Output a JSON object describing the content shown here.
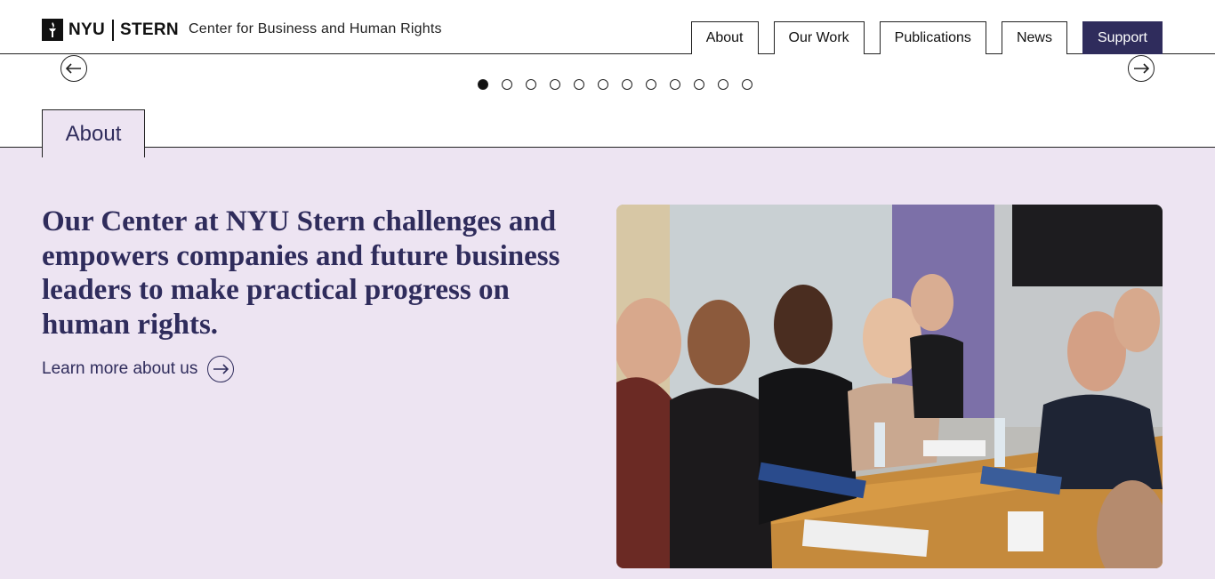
{
  "header": {
    "logo_text": "NYU",
    "logo_text2": "STERN",
    "center_name": "Center for Business and Human Rights",
    "nav": [
      {
        "label": "About"
      },
      {
        "label": "Our Work"
      },
      {
        "label": "Publications"
      },
      {
        "label": "News"
      },
      {
        "label": "Support"
      }
    ]
  },
  "carousel": {
    "prev_icon": "arrow-left-icon",
    "next_icon": "arrow-right-icon",
    "slide_count": 12,
    "active_index": 0
  },
  "about": {
    "tab_label": "About",
    "heading": "Our Center at NYU Stern challenges and empowers companies and future business leaders to make practical progress on human rights.",
    "learn_more": "Learn more about us"
  },
  "colors": {
    "brand_purple": "#2f2c5c",
    "section_bg": "#ede4f2"
  }
}
